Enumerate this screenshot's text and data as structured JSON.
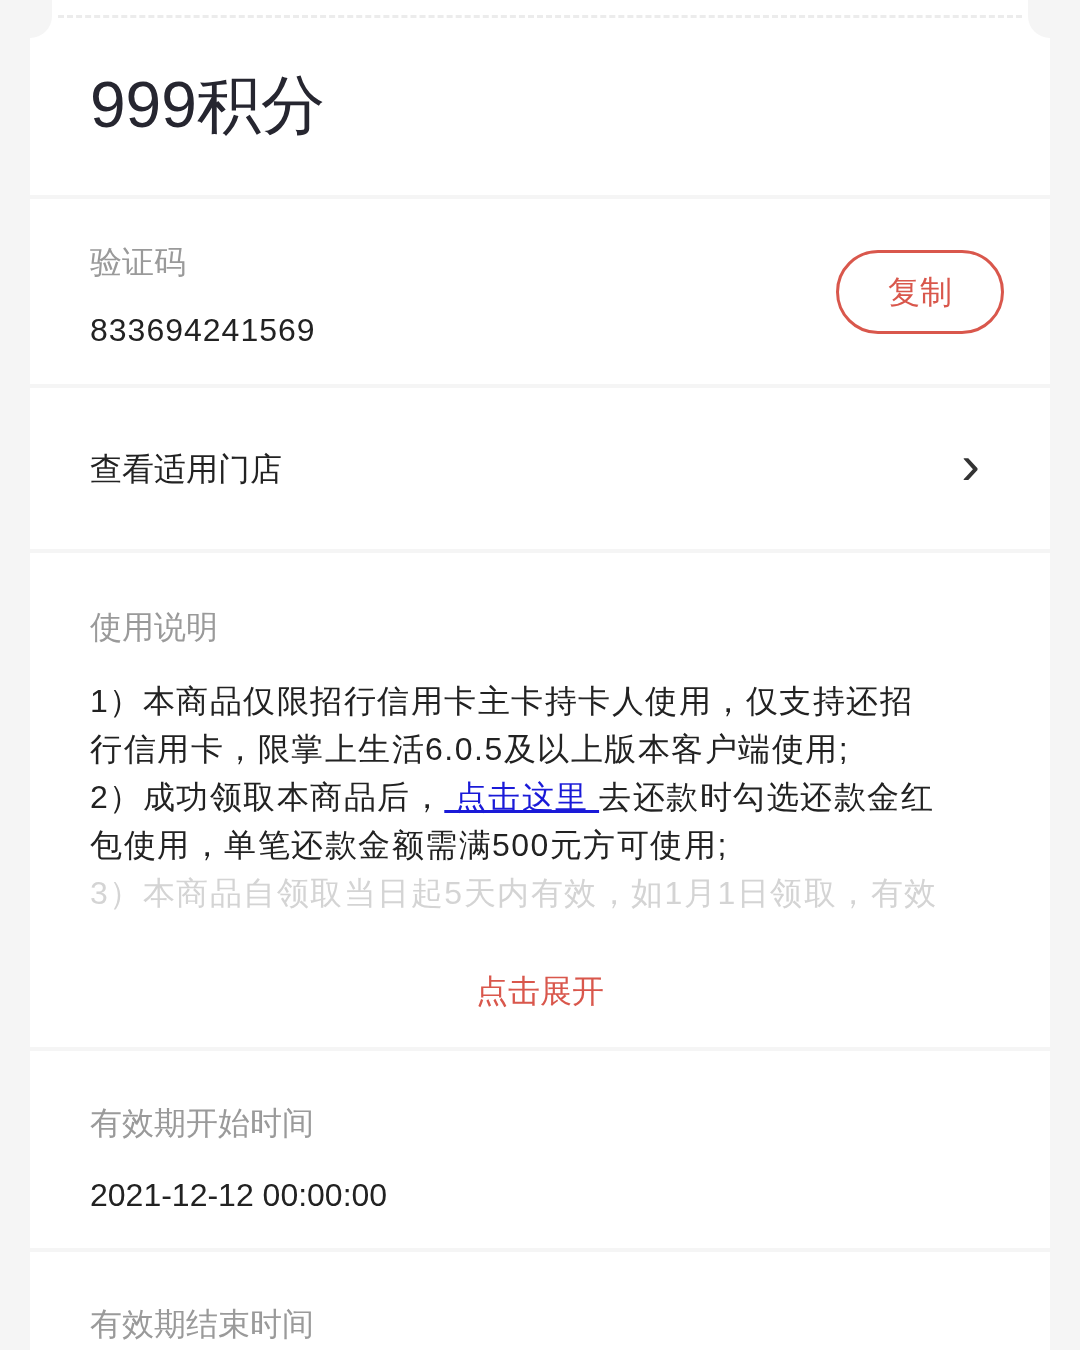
{
  "title": "999积分",
  "code": {
    "label": "验证码",
    "value": "833694241569",
    "button": "复制"
  },
  "stores_link": {
    "label": "查看适用门店",
    "chevron": "›"
  },
  "instructions": {
    "label": "使用说明",
    "lines": [
      {
        "text": "1）本商品仅限招行信用卡主卡持卡人使用，仅支持还招",
        "faded": false
      },
      {
        "text": "行信用卡，限掌上生活6.0.5及以上版本客户端使用;",
        "faded": false
      },
      {
        "text": "2）成功领取本商品后，",
        "link": " 点击这里 ",
        "after": "去还款时勾选还款金红",
        "faded": false
      },
      {
        "text": "包使用，单笔还款金额需满500元方可使用;",
        "faded": false
      },
      {
        "text": "3）本商品自领取当日起5天内有效，如1月1日领取，有效",
        "faded": true
      }
    ],
    "expand": "点击展开"
  },
  "fields": [
    {
      "label": "有效期开始时间",
      "value": "2021-12-12 00:00:00"
    },
    {
      "label": "有效期结束时间"
    }
  ]
}
